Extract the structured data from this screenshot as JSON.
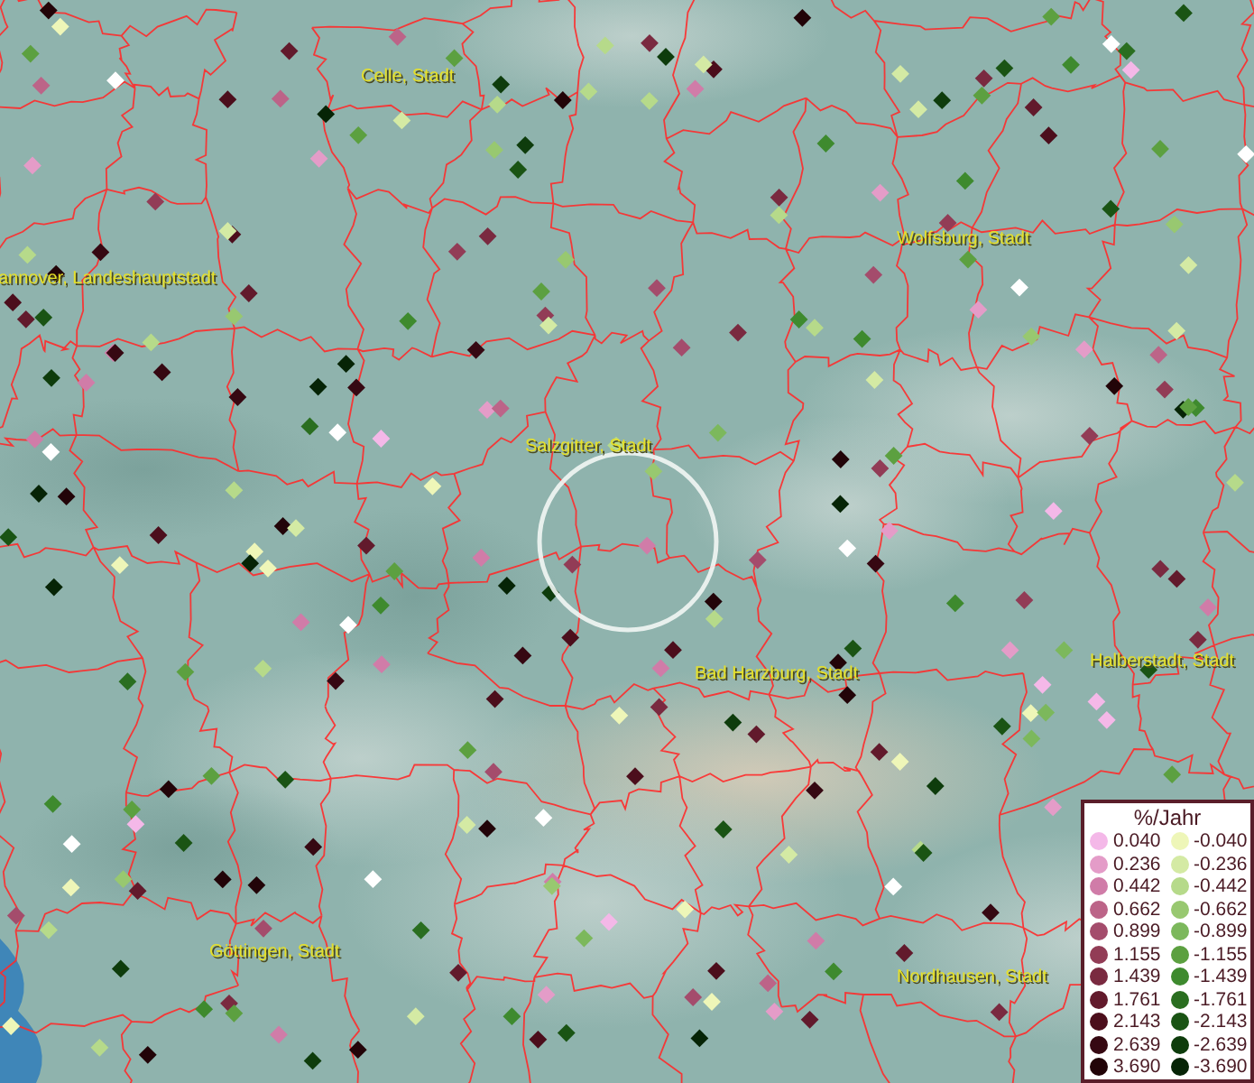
{
  "map": {
    "place_labels": [
      {
        "text": "Celle, Stadt"
      },
      {
        "text": "annover, Landeshauptstadt"
      },
      {
        "text": "Wolfsburg, Stadt"
      },
      {
        "text": "Salzgitter, Stadt"
      },
      {
        "text": "Bad Harzburg, Stadt"
      },
      {
        "text": "Halberstadt, Stadt"
      },
      {
        "text": "Göttingen, Stadt"
      },
      {
        "text": "Nordhausen, Stadt"
      }
    ]
  },
  "legend": {
    "title": "%/Jahr",
    "positive": [
      {
        "value": "0.040",
        "color": "#f4b8e8"
      },
      {
        "value": "0.236",
        "color": "#e49cc8"
      },
      {
        "value": "0.442",
        "color": "#d07ca8"
      },
      {
        "value": "0.662",
        "color": "#bc6488"
      },
      {
        "value": "0.899",
        "color": "#a44c6c"
      },
      {
        "value": "1.155",
        "color": "#923c56"
      },
      {
        "value": "1.439",
        "color": "#7a2a40"
      },
      {
        "value": "1.761",
        "color": "#621a2c"
      },
      {
        "value": "2.143",
        "color": "#4c0e1c"
      },
      {
        "value": "2.639",
        "color": "#360812"
      },
      {
        "value": "3.690",
        "color": "#220408"
      }
    ],
    "negative": [
      {
        "value": "-0.040",
        "color": "#eef6b8"
      },
      {
        "value": "-0.236",
        "color": "#d4eaa4"
      },
      {
        "value": "-0.442",
        "color": "#b6da8a"
      },
      {
        "value": "-0.662",
        "color": "#98c870"
      },
      {
        "value": "-0.899",
        "color": "#7cb85c"
      },
      {
        "value": "-1.155",
        "color": "#5ca040"
      },
      {
        "value": "-1.439",
        "color": "#3e8a2e"
      },
      {
        "value": "-1.761",
        "color": "#2a6e20"
      },
      {
        "value": "-2.143",
        "color": "#1a5414"
      },
      {
        "value": "-2.639",
        "color": "#0e3c0c"
      },
      {
        "value": "-3.690",
        "color": "#062406"
      }
    ]
  }
}
